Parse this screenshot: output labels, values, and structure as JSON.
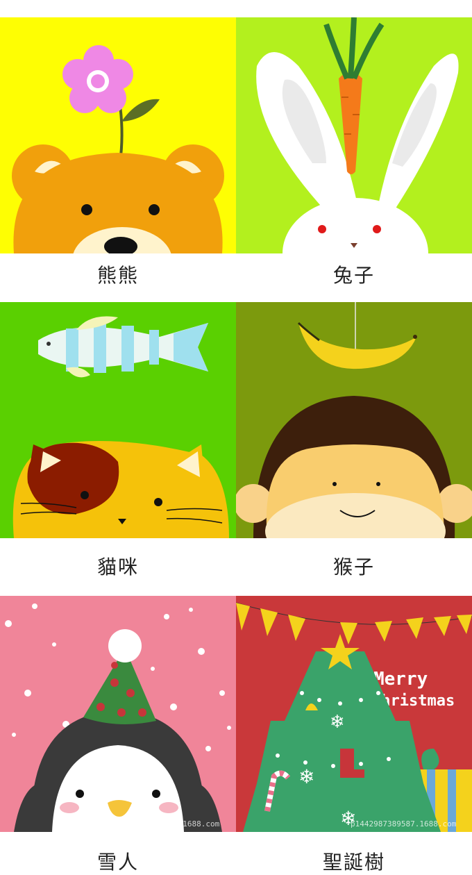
{
  "cards": [
    {
      "caption": "熊熊",
      "bg": "#fefe03"
    },
    {
      "caption": "兔子",
      "bg": "#b3f01e"
    },
    {
      "caption": "貓咪",
      "bg": "#5ad001"
    },
    {
      "caption": "猴子",
      "bg": "#7c9a0d"
    },
    {
      "caption": "雪人",
      "bg": "#f08599"
    },
    {
      "caption": "聖誕樹",
      "bg": "#c9383a",
      "greeting_line1": "Merry",
      "greeting_line2": "christmas"
    }
  ],
  "watermarks": {
    "left": "7.1688.com",
    "right": "p1442987389587.1688.com"
  }
}
